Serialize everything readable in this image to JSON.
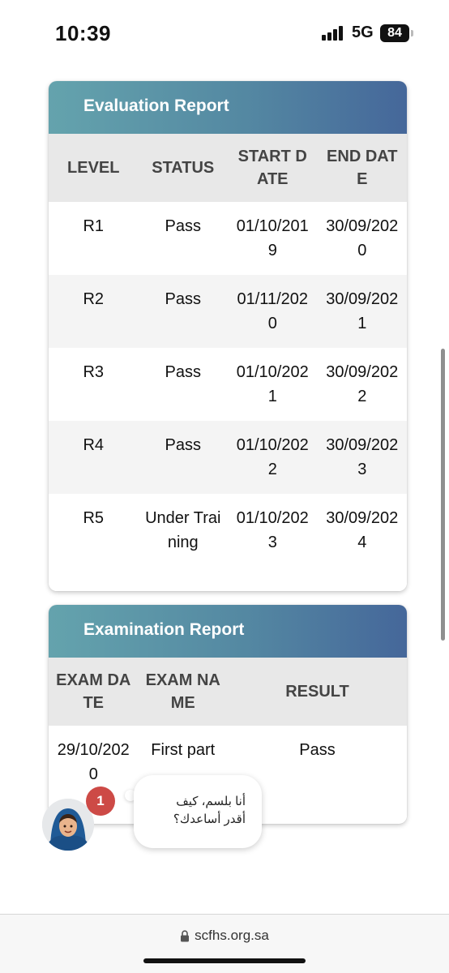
{
  "status_bar": {
    "time": "10:39",
    "network": "5G",
    "battery": "84"
  },
  "evaluation_report": {
    "title": "Evaluation Report",
    "headers": [
      "LEVEL",
      "STATUS",
      "START DATE",
      "END DATE"
    ],
    "rows": [
      [
        "R1",
        "Pass",
        "01/10/2019",
        "30/09/2020"
      ],
      [
        "R2",
        "Pass",
        "01/11/2020",
        "30/09/2021"
      ],
      [
        "R3",
        "Pass",
        "01/10/2021",
        "30/09/2022"
      ],
      [
        "R4",
        "Pass",
        "01/10/2022",
        "30/09/2023"
      ],
      [
        "R5",
        "Under Training",
        "01/10/2023",
        "30/09/2024"
      ]
    ]
  },
  "examination_report": {
    "title": "Examination Report",
    "headers": [
      "EXAM DATE",
      "EXAM NAME",
      "RESULT"
    ],
    "rows": [
      [
        "29/10/2020",
        "First part",
        "Pass"
      ]
    ]
  },
  "chat": {
    "badge_count": "1",
    "line1": "أنا بلسم، كيف",
    "line2": "أقدر أساعدك؟"
  },
  "browser": {
    "url": "scfhs.org.sa"
  }
}
